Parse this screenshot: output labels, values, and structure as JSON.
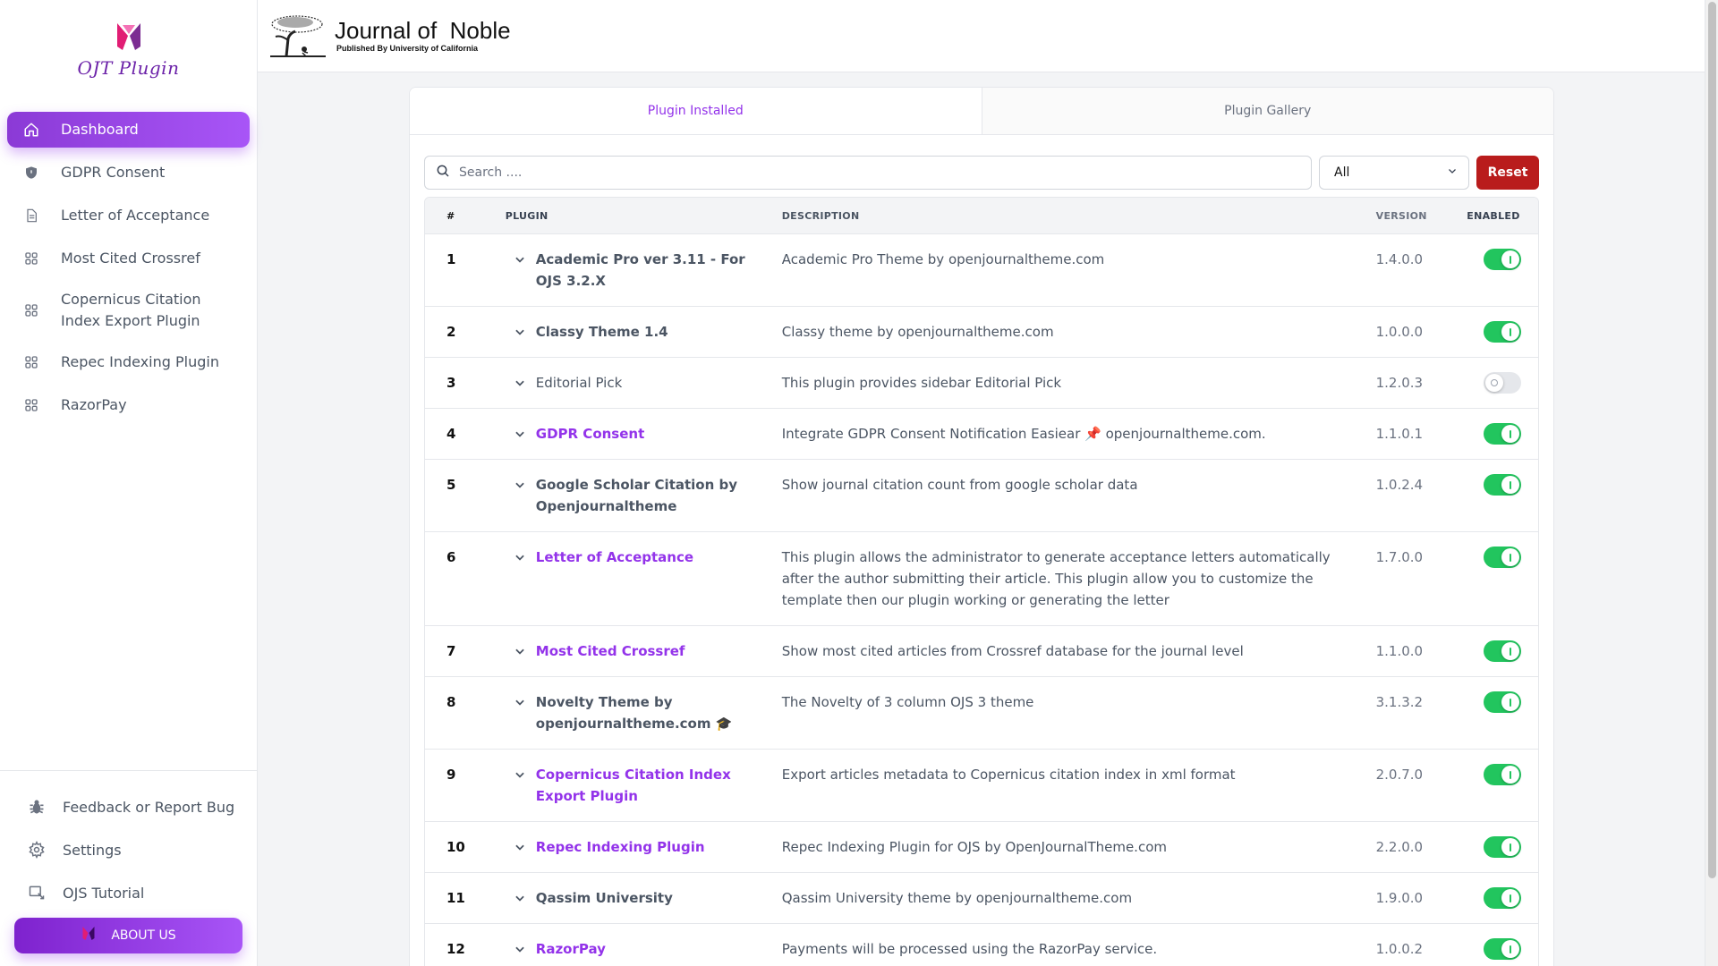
{
  "sidebar": {
    "logo_text": "OJT Plugin",
    "items": [
      {
        "label": "Dashboard",
        "icon": "home-icon",
        "active": true
      },
      {
        "label": "GDPR Consent",
        "icon": "shield-icon"
      },
      {
        "label": "Letter of Acceptance",
        "icon": "document-icon"
      },
      {
        "label": "Most Cited Crossref",
        "icon": "grid-icon"
      },
      {
        "label": "Copernicus Citation Index Export Plugin",
        "icon": "grid-icon"
      },
      {
        "label": "Repec Indexing Plugin",
        "icon": "grid-icon"
      },
      {
        "label": "RazorPay",
        "icon": "grid-icon"
      }
    ],
    "bottom": [
      {
        "label": "Feedback or Report Bug",
        "icon": "bug-icon"
      },
      {
        "label": "Settings",
        "icon": "gear-icon"
      },
      {
        "label": "OJS Tutorial",
        "icon": "tutorial-icon"
      }
    ],
    "about_label": "ABOUT US"
  },
  "header": {
    "title": "Journal of  Noble",
    "subtitle": "Published By University of California"
  },
  "tabs": [
    {
      "label": "Plugin Installed",
      "active": true
    },
    {
      "label": "Plugin Gallery",
      "active": false
    }
  ],
  "toolbar": {
    "search_placeholder": "Search ....",
    "filter_value": "All",
    "reset_label": "Reset"
  },
  "table": {
    "headers": {
      "num": "#",
      "plugin": "PLUGIN",
      "description": "DESCRIPTION",
      "version": "VERSION",
      "enabled": "ENABLED"
    },
    "rows": [
      {
        "num": "1",
        "plugin": "Academic Pro ver 3.11 - For OJS 3.2.X",
        "style": "bold",
        "description": "Academic Pro Theme by openjournaltheme.com",
        "version": "1.4.0.0",
        "enabled": true
      },
      {
        "num": "2",
        "plugin": "Classy Theme 1.4",
        "style": "bold",
        "description": "Classy theme by openjournaltheme.com",
        "version": "1.0.0.0",
        "enabled": true
      },
      {
        "num": "3",
        "plugin": "Editorial Pick",
        "style": "plain",
        "description": "This plugin provides sidebar Editorial Pick",
        "version": "1.2.0.3",
        "enabled": false
      },
      {
        "num": "4",
        "plugin": "GDPR Consent",
        "style": "link",
        "description": "Integrate GDPR Consent Notification Easiear 📌 openjournaltheme.com.",
        "version": "1.1.0.1",
        "enabled": true
      },
      {
        "num": "5",
        "plugin": "Google Scholar Citation by Openjournaltheme",
        "style": "bold",
        "description": "Show journal citation count from google scholar data",
        "version": "1.0.2.4",
        "enabled": true
      },
      {
        "num": "6",
        "plugin": "Letter of Acceptance",
        "style": "link",
        "description": "This plugin allows the administrator to generate acceptance letters automatically after the author submitting their article. This plugin allow you to customize the template then our plugin working or generating the letter",
        "version": "1.7.0.0",
        "enabled": true
      },
      {
        "num": "7",
        "plugin": "Most Cited Crossref",
        "style": "link",
        "description": "Show most cited articles from Crossref database for the journal level",
        "version": "1.1.0.0",
        "enabled": true
      },
      {
        "num": "8",
        "plugin": "Novelty Theme by openjournaltheme.com 🎓",
        "style": "bold",
        "description": "The Novelty of 3 column OJS 3 theme",
        "version": "3.1.3.2",
        "enabled": true
      },
      {
        "num": "9",
        "plugin": "Copernicus Citation Index Export Plugin",
        "style": "link",
        "description": "Export articles metadata to Copernicus citation index in xml format",
        "version": "2.0.7.0",
        "enabled": true
      },
      {
        "num": "10",
        "plugin": "Repec Indexing Plugin",
        "style": "link",
        "description": "Repec Indexing Plugin for OJS by OpenJournalTheme.com",
        "version": "2.2.0.0",
        "enabled": true
      },
      {
        "num": "11",
        "plugin": "Qassim University",
        "style": "bold",
        "description": "Qassim University theme by openjournaltheme.com",
        "version": "1.9.0.0",
        "enabled": true
      },
      {
        "num": "12",
        "plugin": "RazorPay",
        "style": "link",
        "description": "Payments will be processed using the RazorPay service.",
        "version": "1.0.0.2",
        "enabled": true
      }
    ]
  },
  "colors": {
    "accent": "#9333ea",
    "toggle_on": "#22c55e",
    "reset": "#b91c1c"
  }
}
